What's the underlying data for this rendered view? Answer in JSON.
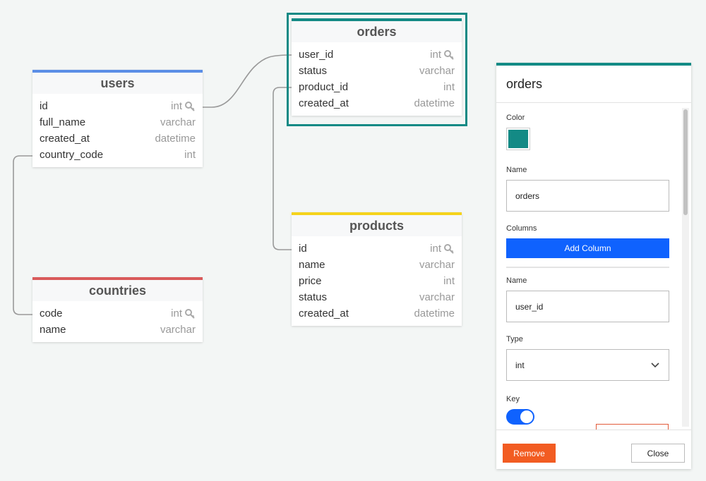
{
  "colors": {
    "canvas_bg": "#f3f6f5",
    "users_accent": "#5b8ee6",
    "orders_accent": "#138a85",
    "products_accent": "#f5d31c",
    "countries_accent": "#d95a5a",
    "primary_button": "#0f62fe",
    "danger_button": "#f25c22"
  },
  "tables": {
    "users": {
      "title": "users",
      "columns": [
        {
          "name": "id",
          "type": "int",
          "key": true
        },
        {
          "name": "full_name",
          "type": "varchar",
          "key": false
        },
        {
          "name": "created_at",
          "type": "datetime",
          "key": false
        },
        {
          "name": "country_code",
          "type": "int",
          "key": false
        }
      ]
    },
    "orders": {
      "title": "orders",
      "columns": [
        {
          "name": "user_id",
          "type": "int",
          "key": true
        },
        {
          "name": "status",
          "type": "varchar",
          "key": false
        },
        {
          "name": "product_id",
          "type": "int",
          "key": false
        },
        {
          "name": "created_at",
          "type": "datetime",
          "key": false
        }
      ]
    },
    "products": {
      "title": "products",
      "columns": [
        {
          "name": "id",
          "type": "int",
          "key": true
        },
        {
          "name": "name",
          "type": "varchar",
          "key": false
        },
        {
          "name": "price",
          "type": "int",
          "key": false
        },
        {
          "name": "status",
          "type": "varchar",
          "key": false
        },
        {
          "name": "created_at",
          "type": "datetime",
          "key": false
        }
      ]
    },
    "countries": {
      "title": "countries",
      "columns": [
        {
          "name": "code",
          "type": "int",
          "key": true
        },
        {
          "name": "name",
          "type": "varchar",
          "key": false
        }
      ]
    }
  },
  "panel": {
    "title": "orders",
    "color_label": "Color",
    "color_value": "#138a85",
    "name_label": "Name",
    "name_value": "orders",
    "columns_label": "Columns",
    "add_column_label": "Add Column",
    "column_name_label": "Name",
    "column_name_value": "user_id",
    "type_label": "Type",
    "type_value": "int",
    "key_label": "Key",
    "key_enabled": true,
    "remove_label": "Remove",
    "close_label": "Close"
  }
}
